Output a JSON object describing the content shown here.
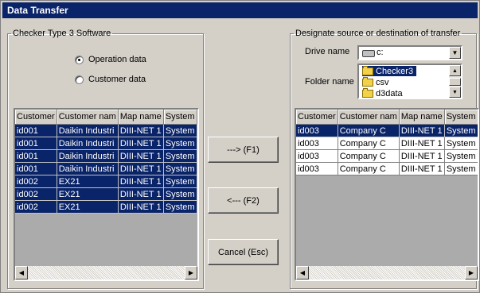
{
  "window": {
    "title": "Data Transfer"
  },
  "left": {
    "legend": "Checker Type 3 Software",
    "radios": [
      {
        "label": "Operation data",
        "checked": true
      },
      {
        "label": "Customer data",
        "checked": false
      }
    ],
    "grid": {
      "columns": [
        "Customer",
        "Customer nam",
        "Map name",
        "System"
      ],
      "rows": [
        {
          "cells": [
            "id001",
            "Daikin Industri",
            "DIII-NET 1",
            "System"
          ],
          "selected": true
        },
        {
          "cells": [
            "id001",
            "Daikin Industri",
            "DIII-NET 1",
            "System"
          ],
          "selected": true
        },
        {
          "cells": [
            "id001",
            "Daikin Industri",
            "DIII-NET 1",
            "System"
          ],
          "selected": true
        },
        {
          "cells": [
            "id001",
            "Daikin Industri",
            "DIII-NET 1",
            "System"
          ],
          "selected": true
        },
        {
          "cells": [
            "id002",
            "EX21",
            "DIII-NET 1",
            "System"
          ],
          "selected": true
        },
        {
          "cells": [
            "id002",
            "EX21",
            "DIII-NET 1",
            "System"
          ],
          "selected": true
        },
        {
          "cells": [
            "id002",
            "EX21",
            "DIII-NET 1",
            "System"
          ],
          "selected": true
        }
      ]
    }
  },
  "buttons": {
    "forward": "---> (F1)",
    "back": "<--- (F2)",
    "cancel": "Cancel (Esc)"
  },
  "right": {
    "legend": "Designate source or destination of transfer",
    "drive_label": "Drive name",
    "drive_value": "c:",
    "folder_label": "Folder name",
    "folders": [
      {
        "name": "Checker3",
        "selected": true
      },
      {
        "name": "csv",
        "selected": false
      },
      {
        "name": "d3data",
        "selected": false
      }
    ],
    "grid": {
      "columns": [
        "Customer",
        "Customer nam",
        "Map name",
        "System"
      ],
      "rows": [
        {
          "cells": [
            "id003",
            "Company C",
            "DIII-NET 1",
            "System"
          ],
          "selected": true
        },
        {
          "cells": [
            "id003",
            "Company C",
            "DIII-NET 1",
            "System"
          ],
          "selected": false
        },
        {
          "cells": [
            "id003",
            "Company C",
            "DIII-NET 1",
            "System"
          ],
          "selected": false
        },
        {
          "cells": [
            "id003",
            "Company C",
            "DIII-NET 1",
            "System"
          ],
          "selected": false
        }
      ]
    }
  },
  "icons": {
    "scroll_left": "arrow-left-icon",
    "scroll_right": "arrow-right-icon",
    "dropdown": "chevron-down-icon",
    "drive": "drive-icon",
    "folder": "folder-icon"
  }
}
